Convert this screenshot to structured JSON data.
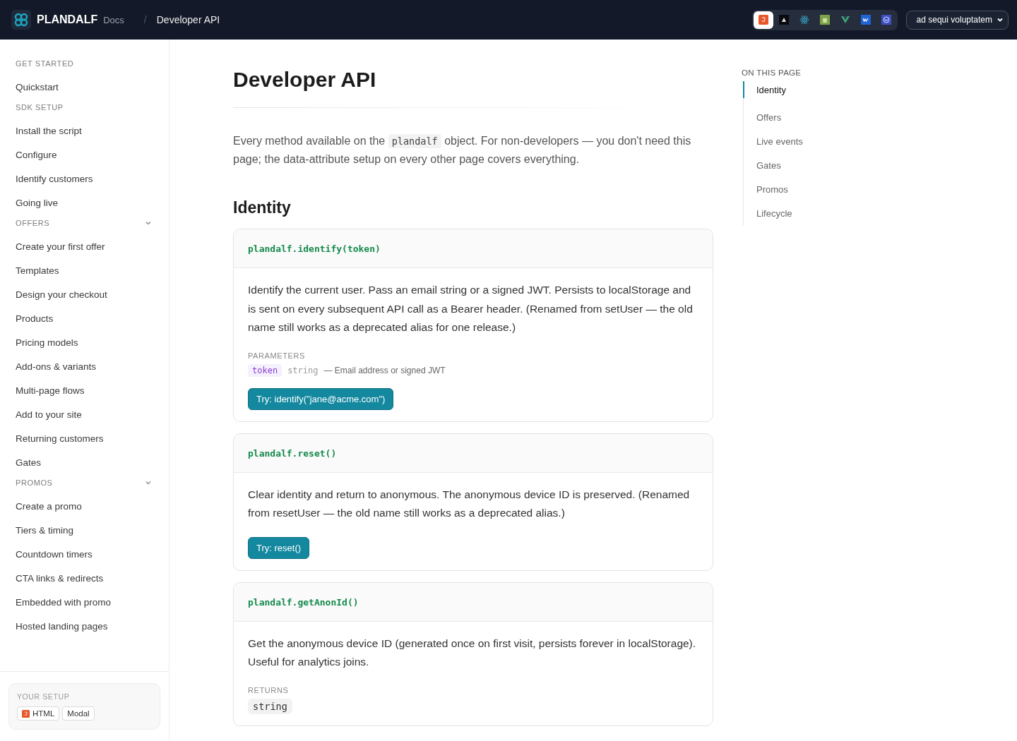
{
  "header": {
    "brand": "PLANDALF",
    "section": "Docs",
    "separator": "/",
    "page": "Developer API",
    "frameworks": [
      {
        "kind": "html",
        "selected": true
      },
      {
        "kind": "astro",
        "selected": false
      },
      {
        "kind": "react",
        "selected": false
      },
      {
        "kind": "shopify",
        "selected": false
      },
      {
        "kind": "vue",
        "selected": false
      },
      {
        "kind": "webflow",
        "selected": false
      },
      {
        "kind": "wordpress",
        "selected": false
      }
    ],
    "workspace": "ad sequi voluptatem"
  },
  "sidebar": {
    "groups": [
      {
        "title": "GET STARTED",
        "collapsible": false,
        "items": [
          "Quickstart"
        ]
      },
      {
        "title": "SDK SETUP",
        "collapsible": false,
        "items": [
          "Install the script",
          "Configure",
          "Identify customers",
          "Going live"
        ]
      },
      {
        "title": "OFFERS",
        "collapsible": true,
        "items": [
          "Create your first offer",
          "Templates",
          "Design your checkout",
          "Products",
          "Pricing models",
          "Add-ons & variants",
          "Multi-page flows",
          "Add to your site",
          "Returning customers",
          "Gates"
        ]
      },
      {
        "title": "PROMOS",
        "collapsible": true,
        "items": [
          "Create a promo",
          "Tiers & timing",
          "Countdown timers",
          "CTA links & redirects",
          "Embedded with promo",
          "Hosted landing pages"
        ]
      }
    ],
    "setup": {
      "title": "YOUR SETUP",
      "chips": [
        {
          "kind": "html",
          "label": "HTML"
        },
        {
          "kind": "plain",
          "label": "Modal"
        }
      ]
    }
  },
  "main": {
    "title": "Developer API",
    "intro": [
      {
        "kind": "text",
        "text": "Every method available on the "
      },
      {
        "kind": "code",
        "text": "plandalf"
      },
      {
        "kind": "text",
        "text": " object. For non-developers — you don't need this page; the data-attribute setup on every other page covers everything."
      }
    ],
    "section": "Identity",
    "methods": [
      {
        "signature": "plandalf.identify(token)",
        "description": "Identify the current user. Pass an email string or a signed JWT. Persists to localStorage and is sent on every subsequent API call as a Bearer header. (Renamed from setUser — the old name still works as a deprecated alias for one release.)",
        "parameters_label": "PARAMETERS",
        "parameters": [
          {
            "name": "token",
            "type": "string",
            "note": "— Email address or signed JWT"
          }
        ],
        "try": "Try: identify(\"jane@acme.com\")"
      },
      {
        "signature": "plandalf.reset()",
        "description": "Clear identity and return to anonymous. The anonymous device ID is preserved. (Renamed from resetUser — the old name still works as a deprecated alias.)",
        "try": "Try: reset()"
      },
      {
        "signature": "plandalf.getAnonId()",
        "description": "Get the anonymous device ID (generated once on first visit, persists forever in localStorage). Useful for analytics joins.",
        "returns_label": "RETURNS",
        "returns": "string"
      }
    ]
  },
  "toc": {
    "title": "ON THIS PAGE",
    "items": [
      {
        "label": "Identity",
        "selected": true
      },
      {
        "label": "Offers",
        "selected": false
      },
      {
        "label": "Live events",
        "selected": false
      },
      {
        "label": "Gates",
        "selected": false
      },
      {
        "label": "Promos",
        "selected": false
      },
      {
        "label": "Lifecycle",
        "selected": false
      }
    ]
  }
}
